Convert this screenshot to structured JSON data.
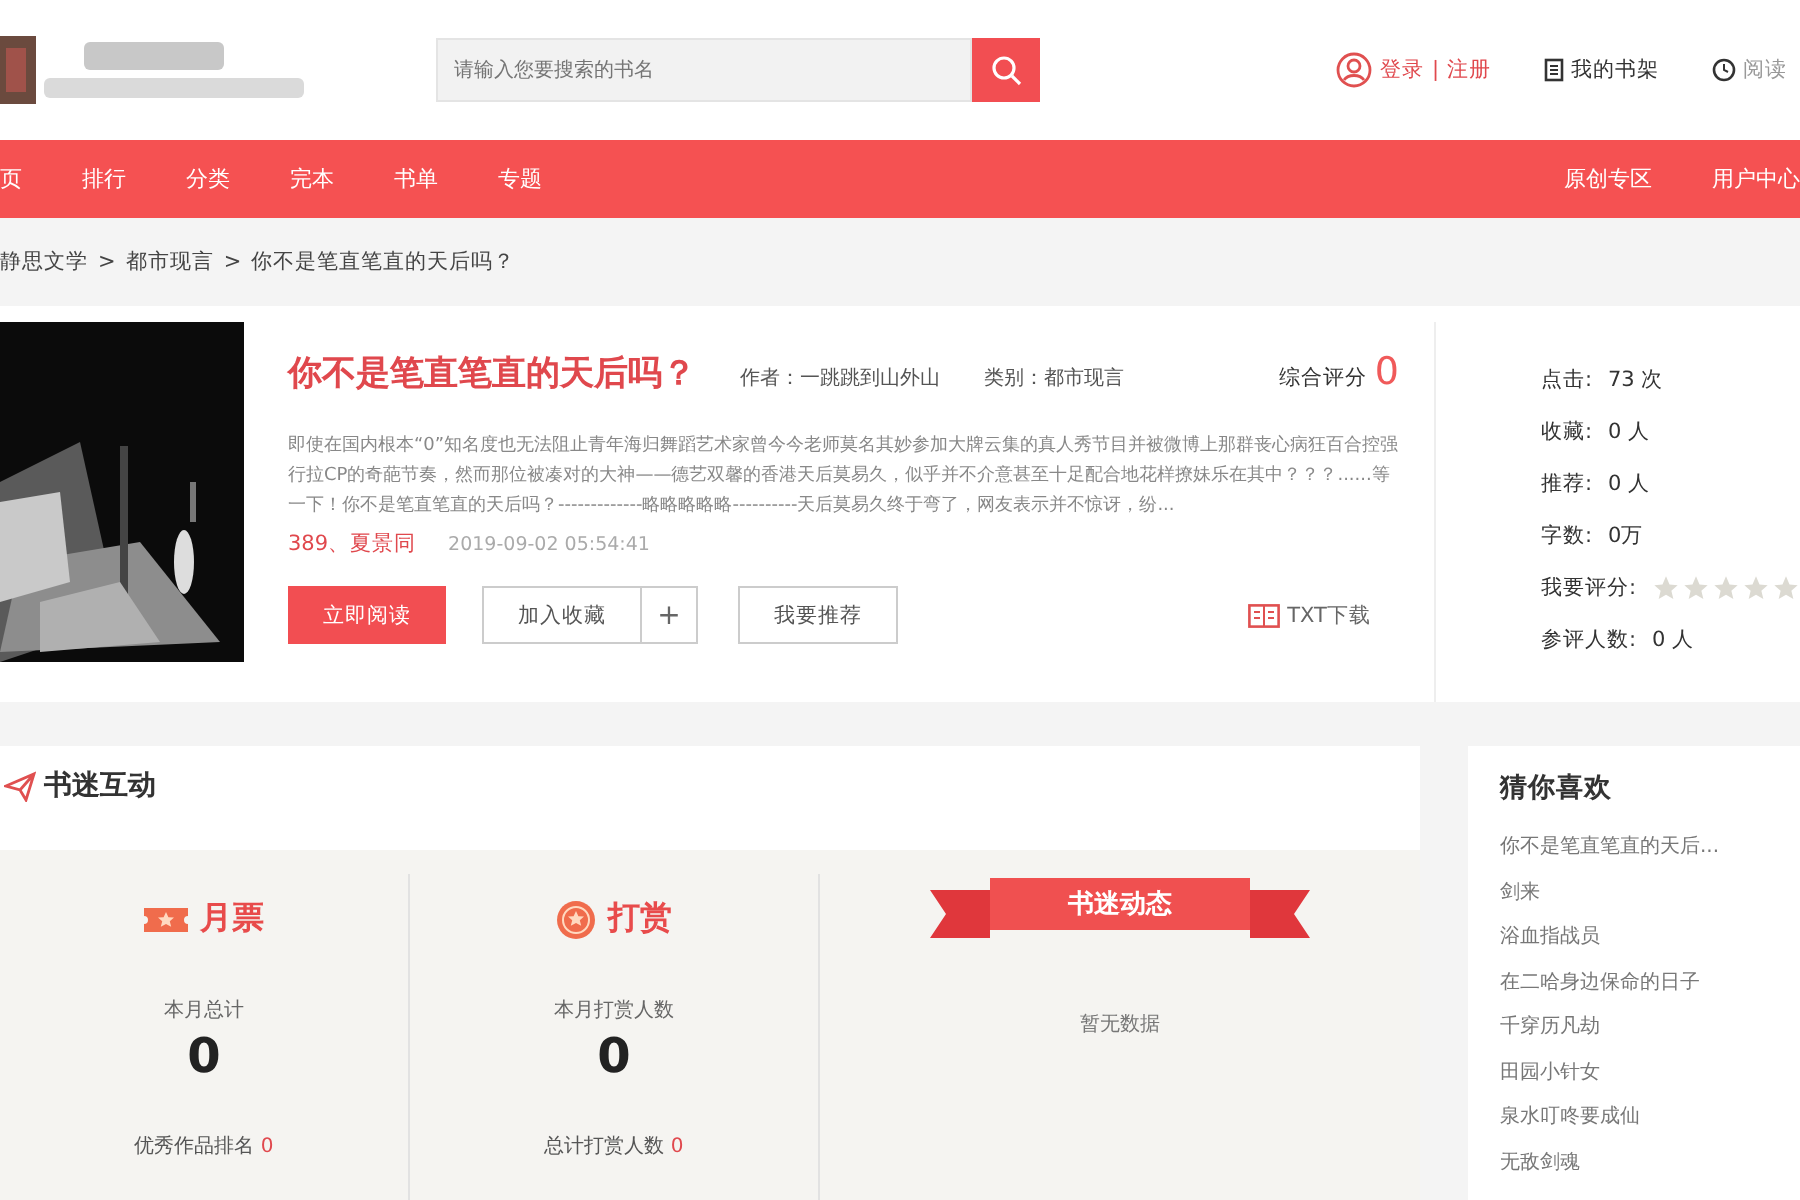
{
  "header": {
    "search": {
      "placeholder": "请输入您要搜索的书名"
    },
    "login": "登录",
    "register": "注册",
    "separator": "|",
    "shelf": "我的书架",
    "history": "阅读"
  },
  "nav": {
    "left": [
      {
        "label": "页"
      },
      {
        "label": "排行"
      },
      {
        "label": "分类"
      },
      {
        "label": "完本"
      },
      {
        "label": "书单"
      },
      {
        "label": "专题"
      }
    ],
    "right": [
      {
        "label": "原创专区"
      },
      {
        "label": "用户中心"
      }
    ]
  },
  "breadcrumb": [
    "静思文学",
    "都市现言",
    "你不是笔直笔直的天后吗？"
  ],
  "breadcrumb_separator": ">",
  "book": {
    "title": "你不是笔直笔直的天后吗？",
    "author_label": "作者：",
    "author": "一跳跳到山外山",
    "category_label": "类别：",
    "category": "都市现言",
    "score_label": "综合评分",
    "score": "0",
    "intro": "即使在国内根本“0”知名度也无法阻止青年海归舞蹈艺术家曾今今老师莫名其妙参加大牌云集的真人秀节目并被微博上那群丧心病狂百合控强行拉CP的奇葩节奏，然而那位被凑对的大神——德艺双馨的香港天后莫易久，似乎并不介意甚至十足配合地花样撩妹乐在其中？？？......等一下！你不是笔直笔直的天后吗？-------------略略略略略----------天后莫易久终于弯了，网友表示并不惊讶，纷...",
    "latest_chapter": "389、夏景同",
    "updated": "2019-09-02 05:54:41",
    "buttons": [
      {
        "label": "立即阅读",
        "kind": "primary"
      },
      {
        "label": "加入收藏",
        "kind": "outline"
      },
      {
        "label": "+",
        "kind": "addon"
      },
      {
        "label": "我要推荐",
        "kind": "outline"
      }
    ],
    "download": "TXT下载"
  },
  "stats": [
    {
      "label": "点击:",
      "value": "73 次"
    },
    {
      "label": "收藏:",
      "value": "0 人"
    },
    {
      "label": "推荐:",
      "value": "0 人"
    },
    {
      "label": "字数:",
      "value": "0万"
    }
  ],
  "rate": {
    "label": "我要评分:",
    "stars": 0
  },
  "raters": {
    "label": "参评人数:",
    "value": "0 人"
  },
  "interaction": {
    "title": "书迷互动",
    "panels": [
      {
        "kind": "ticket",
        "title": "月票",
        "caption": "本月总计",
        "value": "0",
        "footer": "优秀作品排名",
        "footer_value": "0"
      },
      {
        "kind": "reward",
        "title": "打赏",
        "caption": "本月打赏人数",
        "value": "0",
        "footer": "总计打赏人数",
        "footer_value": "0"
      }
    ],
    "feed": {
      "title": "书迷动态",
      "empty": "暂无数据"
    }
  },
  "recommend": {
    "title": "猜你喜欢",
    "items": [
      "你不是笔直笔直的天后...",
      "剑来",
      "浴血指战员",
      "在二哈身边保命的日子",
      "千穿历凡劫",
      "田园小针女",
      "泉水叮咚要成仙",
      "无敌剑魂"
    ]
  }
}
